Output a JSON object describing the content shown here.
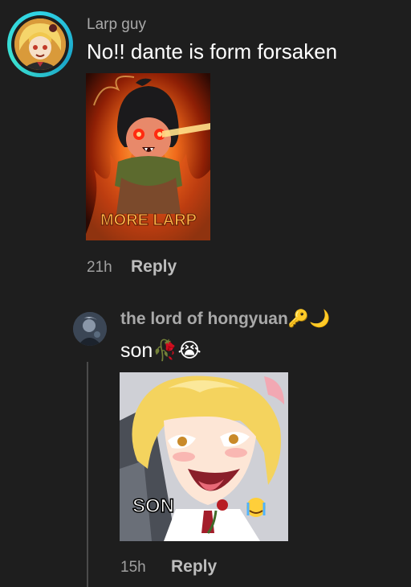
{
  "comment": {
    "username": "Larp guy",
    "text": "No!! dante is form forsaken",
    "image_caption": "MORE LARP",
    "time": "21h",
    "reply_label": "Reply"
  },
  "reply": {
    "username": "the lord of hongyuan",
    "username_emojis": "🔑🌙",
    "text": "son",
    "text_emojis": "🥀😭",
    "image_caption": "SON",
    "time": "15h",
    "reply_label": "Reply"
  },
  "colors": {
    "background": "#1e1e1e",
    "avatar_ring": "#2fd3e6",
    "muted_text": "#a9a9a9"
  }
}
